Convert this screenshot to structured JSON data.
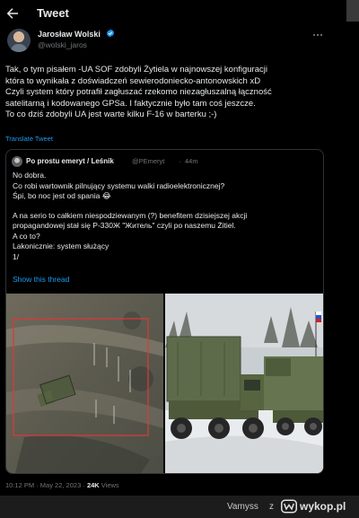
{
  "header": {
    "title": "Tweet",
    "back_icon": "arrow-left-icon"
  },
  "author": {
    "name": "Jarosław Wolski",
    "handle": "@wolski_jaros",
    "verified": true
  },
  "tweet": {
    "lines": [
      "Tak, o tym pisałem -UA SOF zdobyli Żytiela w najnowszej konfiguracji",
      "która to wynikała z doświadczeń sewierodoniecko-antonowskich xD",
      "Czyli system który potrafił zagłuszać  rzekomo niezagłuszalną łączność",
      "satelitarną  i kodowanego  GPSa. I faktycznie było tam coś jeszcze.",
      "To co dziś zdobyli UA jest warte kilku F-16 w barterku ;-)"
    ],
    "translate_label": "Translate Tweet"
  },
  "quote": {
    "name": "Po prostu emeryt / Leśnik",
    "handle": "@PEmeryt",
    "separator": "·",
    "time": "44m",
    "lines": [
      "No dobra.",
      "Co robi wartownik pilnujący systemu walki radioelektronicznej?",
      "Śpi, bo noc jest od spania 😂",
      "",
      "A na serio to całkiem niespodziewanym (?) benefitem dzisiejszej akcji",
      "propagandowej stał się Р-330Ж \"Житель\" czyli po naszemu Żitiel.",
      "A co to?",
      "Lakonicznie: system służący",
      "1/"
    ],
    "show_thread_label": "Show this thread"
  },
  "meta": {
    "time": "10:12 PM",
    "separator": "·",
    "date": "May 22, 2023",
    "views_count": "24K",
    "views_label": "Views"
  },
  "footer": {
    "user": "Vamyss",
    "z": "z",
    "site": "wykop.pl"
  },
  "colors": {
    "background": "#000000",
    "text": "#e7e9ea",
    "muted": "#71767b",
    "link": "#1d9bf0",
    "border": "#2f3336"
  }
}
